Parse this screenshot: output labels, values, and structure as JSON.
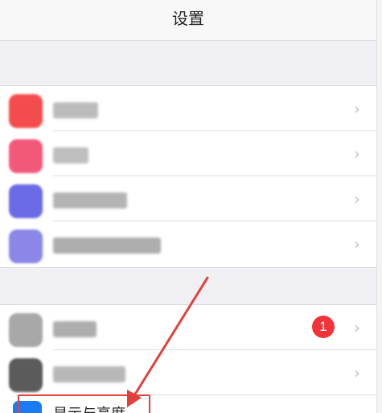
{
  "nav": {
    "title": "设置"
  },
  "group_top": {
    "rows": [
      {
        "icon_color": "#f44c4c",
        "label_color": "#b0b0b0",
        "label_width": 56
      },
      {
        "icon_color": "#f2587a",
        "label_color": "#b3b3b3",
        "label_width": 44
      },
      {
        "icon_color": "#6a6ae6",
        "label_color": "#a8a8a8",
        "label_width": 92
      },
      {
        "icon_color": "#8b87e8",
        "label_color": "#a0a0a0",
        "label_width": 134
      }
    ]
  },
  "group_bottom": {
    "rows": [
      {
        "icon_color": "#a8a8a8",
        "label_color": "#a0a0a0",
        "label_width": 54,
        "badge": "1"
      },
      {
        "icon_color": "#5b5b5b",
        "label_color": "#ababab",
        "label_width": 90
      }
    ],
    "highlighted_label": "显示与亮度",
    "highlighted_icon_color": "#1a7cf5"
  },
  "chevron": "›",
  "annotation": {
    "color": "#e2403a"
  }
}
